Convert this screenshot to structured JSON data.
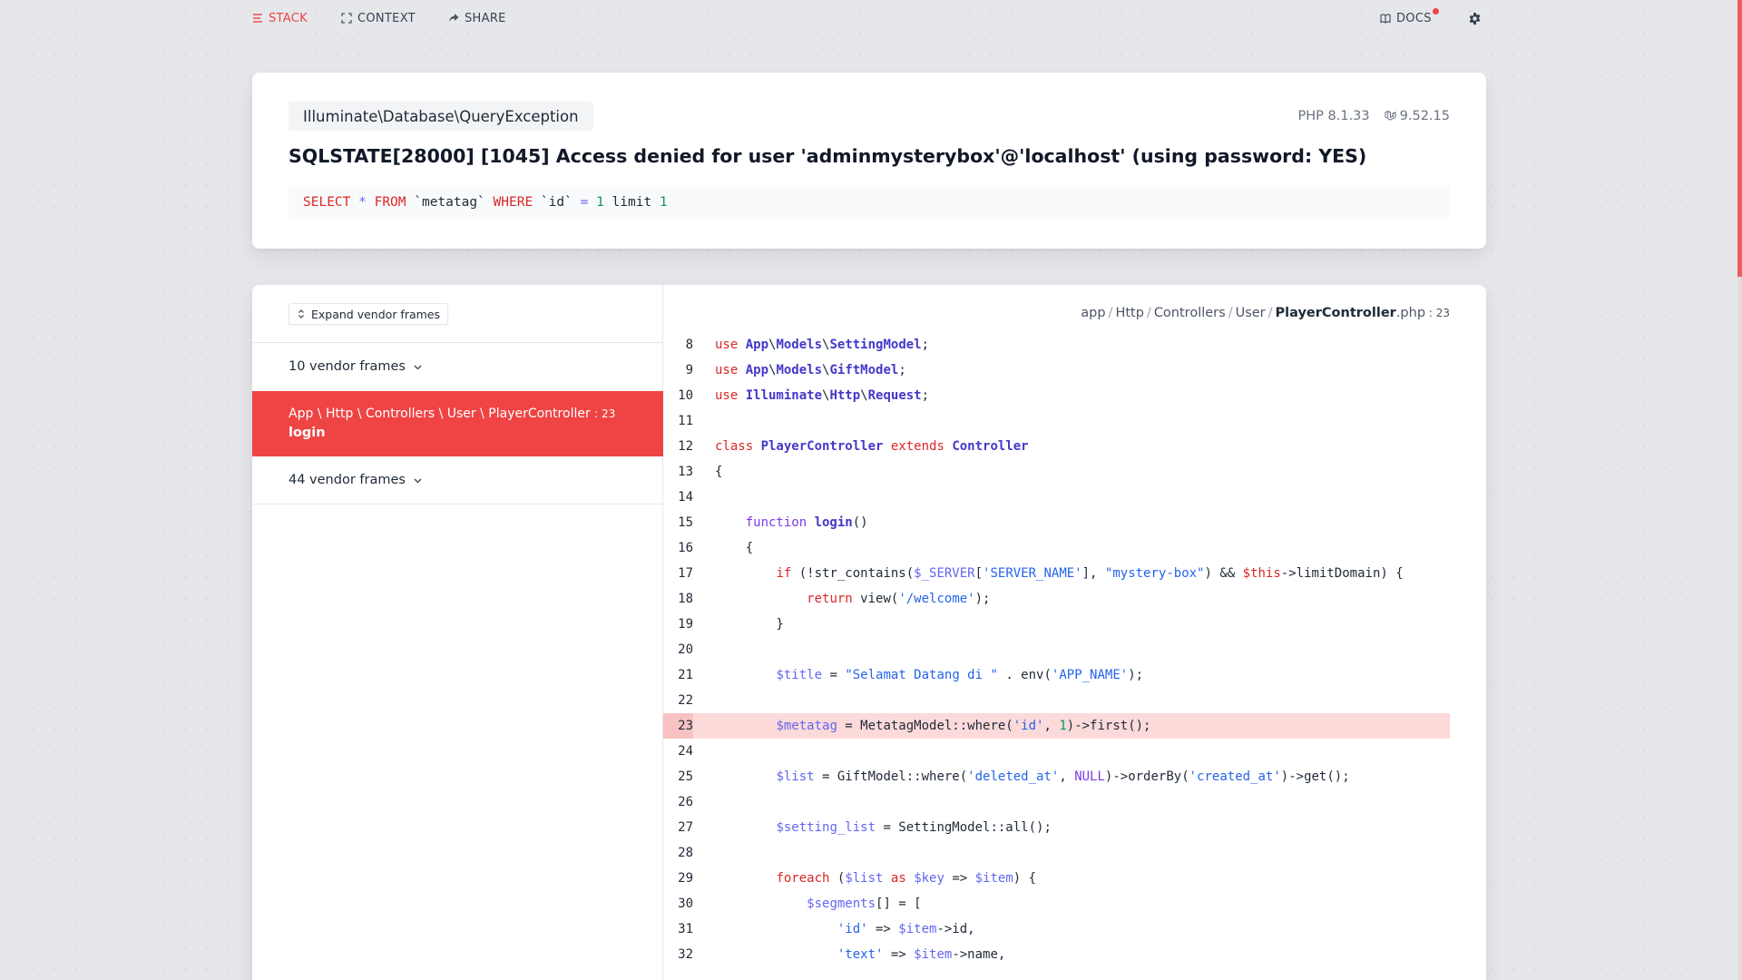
{
  "nav": {
    "stack": "STACK",
    "context": "CONTEXT",
    "share": "SHARE",
    "docs": "DOCS"
  },
  "colors": {
    "accent": "#ef4444",
    "highlight_line": "#fcdada"
  },
  "exception": {
    "class_parts": [
      "Illuminate",
      "Database",
      "QueryException"
    ],
    "php_version": "PHP 8.1.33",
    "laravel_version": "9.52.15",
    "message": "SQLSTATE[28000] [1045] Access denied for user 'adminmysterybox'@'localhost' (using password: YES)",
    "sql": [
      {
        "t": "SELECT",
        "c": "k"
      },
      {
        "t": " ",
        "c": ""
      },
      {
        "t": "*",
        "c": "v"
      },
      {
        "t": " ",
        "c": ""
      },
      {
        "t": "FROM",
        "c": "k"
      },
      {
        "t": " `metatag` ",
        "c": ""
      },
      {
        "t": "WHERE",
        "c": "k"
      },
      {
        "t": " `id` ",
        "c": ""
      },
      {
        "t": "=",
        "c": "v"
      },
      {
        "t": " ",
        "c": ""
      },
      {
        "t": "1",
        "c": "n"
      },
      {
        "t": " limit ",
        "c": ""
      },
      {
        "t": "1",
        "c": "n"
      }
    ]
  },
  "frames": {
    "expand_label": "Expand vendor frames",
    "vendor_top": "10 vendor frames",
    "active_path": "App \\ Http \\ Controllers \\ User \\ PlayerController",
    "active_line": ": 23",
    "active_method": "login",
    "vendor_bottom": "44 vendor frames"
  },
  "file": {
    "dirs": [
      "app",
      "Http",
      "Controllers",
      "User"
    ],
    "name": "PlayerController",
    "ext": ".php",
    "line": ": 23"
  },
  "code": [
    {
      "n": "8",
      "tokens": [
        {
          "t": "use ",
          "c": "k"
        },
        {
          "t": "App",
          "c": "c"
        },
        {
          "t": "\\",
          "c": ""
        },
        {
          "t": "Models",
          "c": "c"
        },
        {
          "t": "\\",
          "c": ""
        },
        {
          "t": "SettingModel",
          "c": "c"
        },
        {
          "t": ";",
          "c": ""
        }
      ]
    },
    {
      "n": "9",
      "tokens": [
        {
          "t": "use ",
          "c": "k"
        },
        {
          "t": "App",
          "c": "c"
        },
        {
          "t": "\\",
          "c": ""
        },
        {
          "t": "Models",
          "c": "c"
        },
        {
          "t": "\\",
          "c": ""
        },
        {
          "t": "GiftModel",
          "c": "c"
        },
        {
          "t": ";",
          "c": ""
        }
      ]
    },
    {
      "n": "10",
      "tokens": [
        {
          "t": "use ",
          "c": "k"
        },
        {
          "t": "Illuminate",
          "c": "c"
        },
        {
          "t": "\\",
          "c": ""
        },
        {
          "t": "Http",
          "c": "c"
        },
        {
          "t": "\\",
          "c": ""
        },
        {
          "t": "Request",
          "c": "c"
        },
        {
          "t": ";",
          "c": ""
        }
      ]
    },
    {
      "n": "11",
      "tokens": []
    },
    {
      "n": "12",
      "tokens": [
        {
          "t": "class ",
          "c": "k"
        },
        {
          "t": "PlayerController",
          "c": "c"
        },
        {
          "t": " ",
          "c": ""
        },
        {
          "t": "extends ",
          "c": "k"
        },
        {
          "t": "Controller",
          "c": "c"
        }
      ]
    },
    {
      "n": "13",
      "tokens": [
        {
          "t": "{",
          "c": ""
        }
      ]
    },
    {
      "n": "14",
      "tokens": []
    },
    {
      "n": "15",
      "tokens": [
        {
          "t": "    ",
          "c": ""
        },
        {
          "t": "function ",
          "c": "f"
        },
        {
          "t": "login",
          "c": "fn"
        },
        {
          "t": "()",
          "c": ""
        }
      ]
    },
    {
      "n": "16",
      "tokens": [
        {
          "t": "    {",
          "c": ""
        }
      ]
    },
    {
      "n": "17",
      "tokens": [
        {
          "t": "        ",
          "c": ""
        },
        {
          "t": "if",
          "c": "k"
        },
        {
          "t": " (!str_contains(",
          "c": ""
        },
        {
          "t": "$_SERVER",
          "c": "v"
        },
        {
          "t": "[",
          "c": ""
        },
        {
          "t": "'SERVER_NAME'",
          "c": "s"
        },
        {
          "t": "], ",
          "c": ""
        },
        {
          "t": "\"mystery-box\"",
          "c": "s"
        },
        {
          "t": ") && ",
          "c": ""
        },
        {
          "t": "$this",
          "c": "k"
        },
        {
          "t": "->limitDomain) {",
          "c": ""
        }
      ]
    },
    {
      "n": "18",
      "tokens": [
        {
          "t": "            ",
          "c": ""
        },
        {
          "t": "return",
          "c": "k"
        },
        {
          "t": " view(",
          "c": ""
        },
        {
          "t": "'/welcome'",
          "c": "s"
        },
        {
          "t": ");",
          "c": ""
        }
      ]
    },
    {
      "n": "19",
      "tokens": [
        {
          "t": "        }",
          "c": ""
        }
      ]
    },
    {
      "n": "20",
      "tokens": []
    },
    {
      "n": "21",
      "tokens": [
        {
          "t": "        ",
          "c": ""
        },
        {
          "t": "$title",
          "c": "v"
        },
        {
          "t": " = ",
          "c": ""
        },
        {
          "t": "\"Selamat Datang di \"",
          "c": "s"
        },
        {
          "t": " . env(",
          "c": ""
        },
        {
          "t": "'APP_NAME'",
          "c": "s"
        },
        {
          "t": ");",
          "c": ""
        }
      ]
    },
    {
      "n": "22",
      "tokens": []
    },
    {
      "n": "23",
      "hl": true,
      "tokens": [
        {
          "t": "        ",
          "c": ""
        },
        {
          "t": "$metatag",
          "c": "v"
        },
        {
          "t": " = MetatagModel::where(",
          "c": ""
        },
        {
          "t": "'id'",
          "c": "s"
        },
        {
          "t": ", ",
          "c": ""
        },
        {
          "t": "1",
          "c": "n"
        },
        {
          "t": ")->first();",
          "c": ""
        }
      ]
    },
    {
      "n": "24",
      "tokens": []
    },
    {
      "n": "25",
      "tokens": [
        {
          "t": "        ",
          "c": ""
        },
        {
          "t": "$list",
          "c": "v"
        },
        {
          "t": " = GiftModel::where(",
          "c": ""
        },
        {
          "t": "'deleted_at'",
          "c": "s"
        },
        {
          "t": ", ",
          "c": ""
        },
        {
          "t": "NULL",
          "c": "f"
        },
        {
          "t": ")->orderBy(",
          "c": ""
        },
        {
          "t": "'created_at'",
          "c": "s"
        },
        {
          "t": ")->get();",
          "c": ""
        }
      ]
    },
    {
      "n": "26",
      "tokens": []
    },
    {
      "n": "27",
      "tokens": [
        {
          "t": "        ",
          "c": ""
        },
        {
          "t": "$setting_list",
          "c": "v"
        },
        {
          "t": " = SettingModel::all();",
          "c": ""
        }
      ]
    },
    {
      "n": "28",
      "tokens": []
    },
    {
      "n": "29",
      "tokens": [
        {
          "t": "        ",
          "c": ""
        },
        {
          "t": "foreach",
          "c": "k"
        },
        {
          "t": " (",
          "c": ""
        },
        {
          "t": "$list",
          "c": "v"
        },
        {
          "t": " ",
          "c": ""
        },
        {
          "t": "as",
          "c": "k"
        },
        {
          "t": " ",
          "c": ""
        },
        {
          "t": "$key",
          "c": "v"
        },
        {
          "t": " => ",
          "c": ""
        },
        {
          "t": "$item",
          "c": "v"
        },
        {
          "t": ") {",
          "c": ""
        }
      ]
    },
    {
      "n": "30",
      "tokens": [
        {
          "t": "            ",
          "c": ""
        },
        {
          "t": "$segments",
          "c": "v"
        },
        {
          "t": "[] = [",
          "c": ""
        }
      ]
    },
    {
      "n": "31",
      "tokens": [
        {
          "t": "                ",
          "c": ""
        },
        {
          "t": "'id'",
          "c": "s"
        },
        {
          "t": " => ",
          "c": ""
        },
        {
          "t": "$item",
          "c": "v"
        },
        {
          "t": "->id,",
          "c": ""
        }
      ]
    },
    {
      "n": "32",
      "tokens": [
        {
          "t": "                ",
          "c": ""
        },
        {
          "t": "'text'",
          "c": "s"
        },
        {
          "t": " => ",
          "c": ""
        },
        {
          "t": "$item",
          "c": "v"
        },
        {
          "t": "->name,",
          "c": ""
        }
      ]
    }
  ]
}
